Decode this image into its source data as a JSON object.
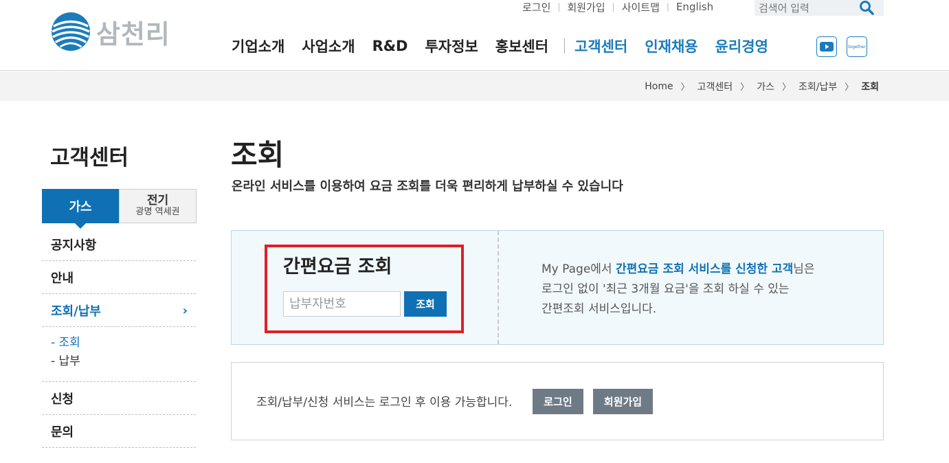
{
  "logo": {
    "text": "삼천리"
  },
  "util_links": [
    "로그인",
    "회원가입",
    "사이트맵",
    "English"
  ],
  "search": {
    "placeholder": "검색어 입력"
  },
  "gnb": {
    "left": [
      "기업소개",
      "사업소개",
      "R&D",
      "투자정보",
      "홍보센터"
    ],
    "right": [
      "고객센터",
      "인재채용",
      "윤리경영"
    ]
  },
  "sns": {
    "together_label": "together"
  },
  "breadcrumb": [
    "Home",
    "고객센터",
    "가스",
    "조회/납부",
    "조회"
  ],
  "lnb": {
    "title": "고객센터",
    "tab_active": "가스",
    "tab_inactive_line1": "전기",
    "tab_inactive_line2": "광명 역세권",
    "items": [
      "공지사항",
      "안내",
      "조회/납부"
    ],
    "sub_items": [
      "-  조회",
      "-  납부"
    ],
    "items_after": [
      "신청",
      "문의"
    ]
  },
  "main": {
    "title": "조회",
    "description": "온라인 서비스를 이용하여 요금 조회를 더욱 편리하게 납부하실 수 있습니다",
    "quick": {
      "title": "간편요금 조회",
      "input_placeholder": "납부자번호",
      "button": "조회"
    },
    "info": {
      "line1_pre": "My Page에서 ",
      "line1_hl": "간편요금 조회 서비스를 신청한 고객",
      "line1_post": "님은",
      "line2": "로그인 없이 '최근 3개월 요금'을 조회 하실 수 있는",
      "line3": "간편조회 서비스입니다."
    },
    "login_notice": "조회/납부/신청 서비스는 로그인 후 이용 가능합니다.",
    "login_button": "로그인",
    "join_button": "회원가입"
  },
  "colors": {
    "primary": "#0f71b4",
    "highlight_border": "#e01e26",
    "gray_button": "#6e7b86"
  }
}
